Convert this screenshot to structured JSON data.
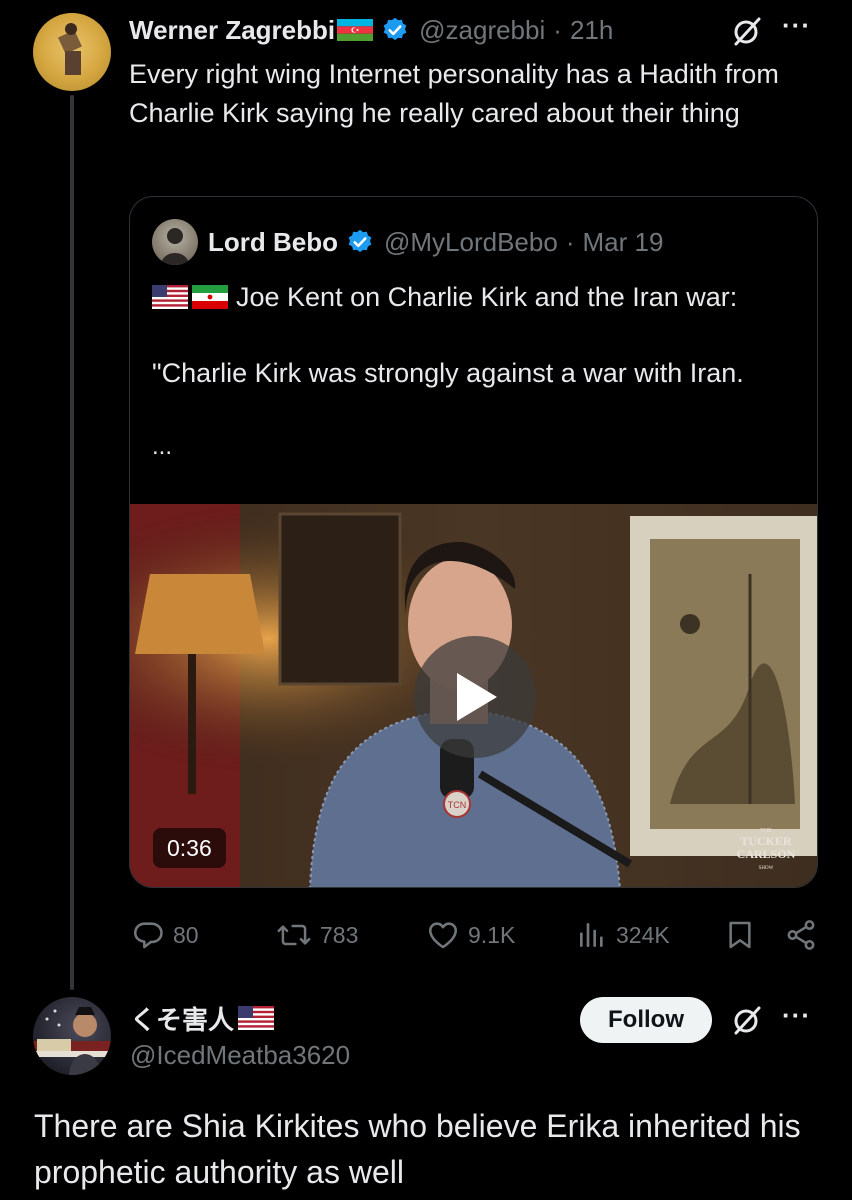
{
  "tweet": {
    "author_name": "Werner Zagrebbi",
    "author_handle": "@zagrebbi",
    "separator": "·",
    "time": "21h",
    "more": "···",
    "text": "Every right wing Internet personality has a Hadith from Charlie Kirk saying he really cared about their thing",
    "flag": "azerbaijan-flag",
    "quote": {
      "author_name": "Lord Bebo",
      "author_handle": "@MyLordBebo",
      "separator": "·",
      "date": "Mar 19",
      "line1": "Joe Kent on Charlie Kirk and the Iran war:",
      "line2": "\"Charlie Kirk was strongly against a war with Iran.",
      "ellipsis": "...",
      "flags": [
        "us-flag",
        "iran-flag"
      ],
      "video": {
        "duration": "0:36",
        "watermark": [
          "THE",
          "TUCKER",
          "CARLSON",
          "SHOW"
        ],
        "mic_logo": "TCN"
      }
    },
    "actions": {
      "replies": "80",
      "reposts": "783",
      "likes": "9.1K",
      "views": "324K"
    }
  },
  "reply": {
    "author_name": "くそ害人",
    "author_handle": "@IcedMeatba3620",
    "flag": "us-flag",
    "follow_label": "Follow",
    "more": "···",
    "text": "There are Shia Kirkites who believe Erika inherited his prophetic authority as well"
  },
  "colors": {
    "background": "#000000",
    "text": "#e7e9ea",
    "muted": "#71767b",
    "verified": "#1d9bf0",
    "border": "#2f3336"
  }
}
